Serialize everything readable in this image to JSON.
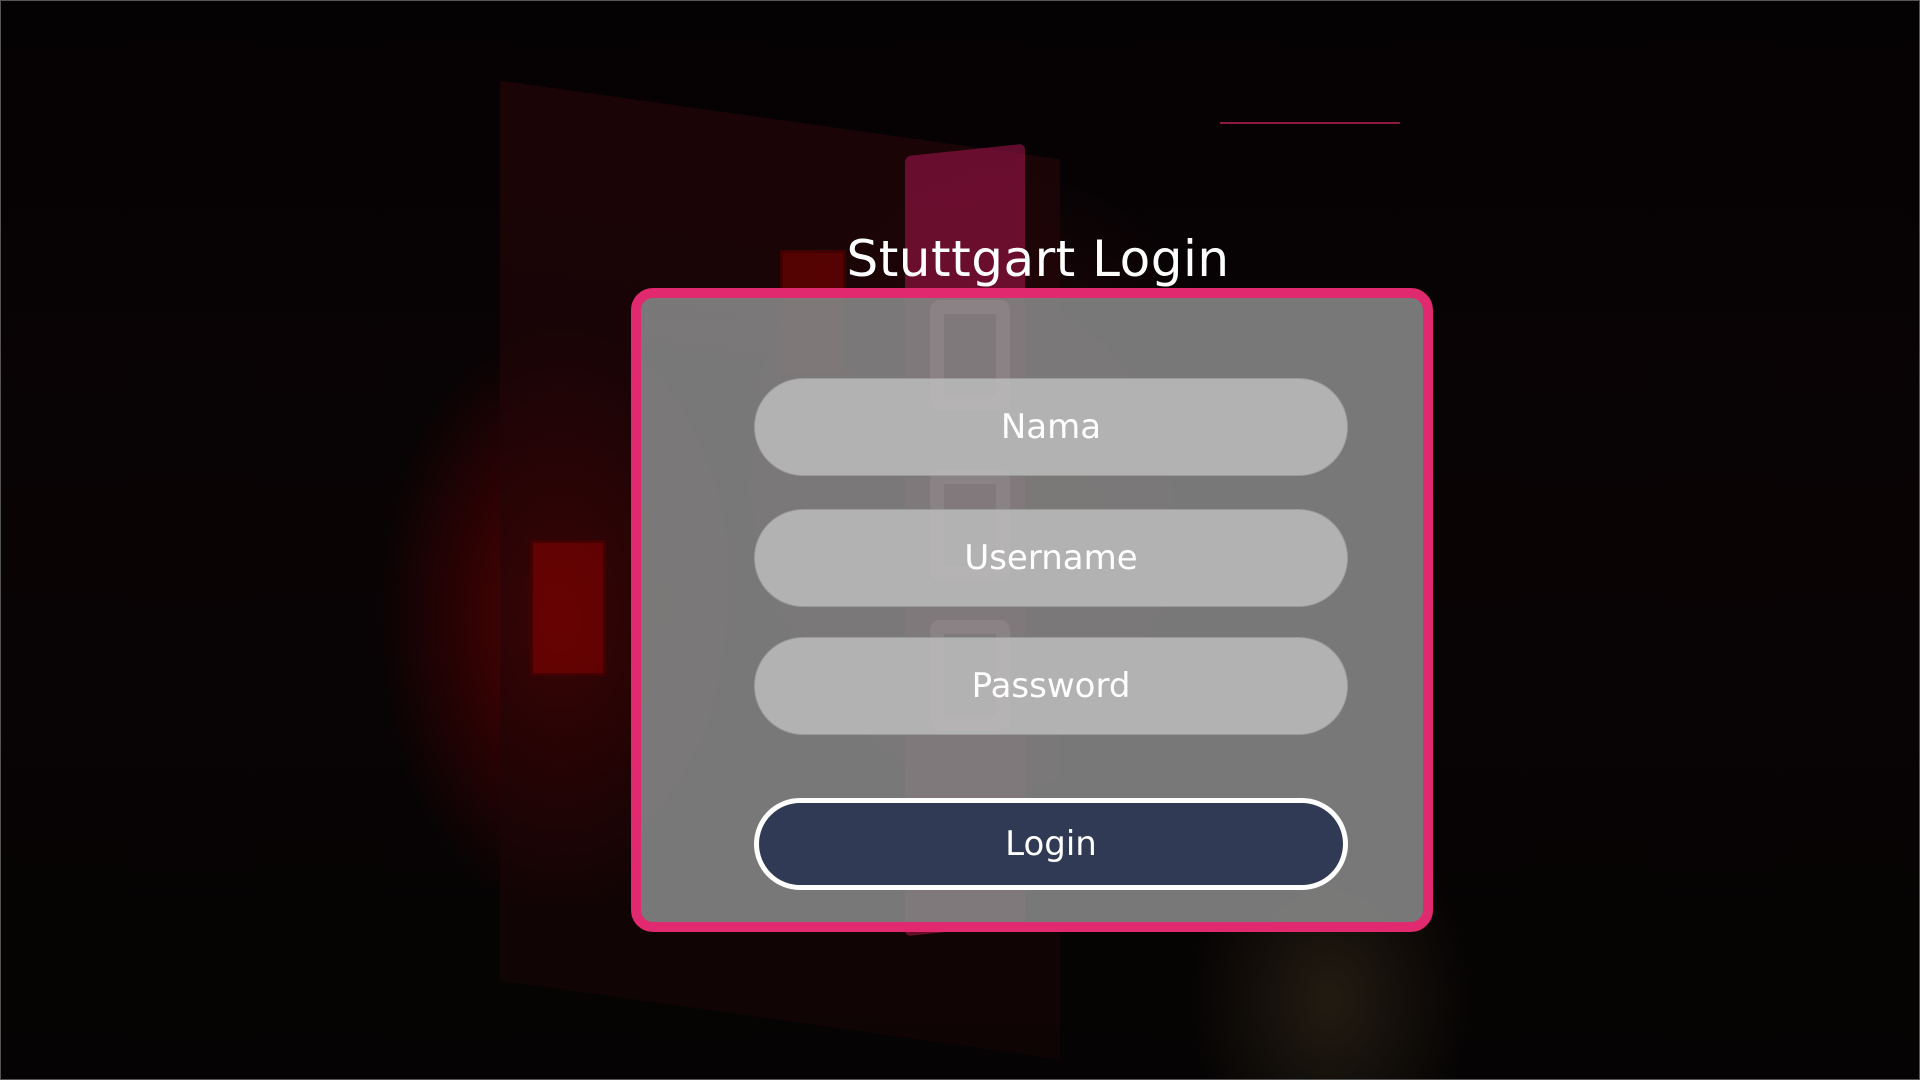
{
  "page": {
    "title": "Stuttgart Login"
  },
  "form": {
    "name_placeholder": "Nama",
    "username_placeholder": "Username",
    "password_placeholder": "Password",
    "submit_label": "Login"
  },
  "colors": {
    "accent": "#e0296e",
    "button_bg": "#313a54",
    "card_bg": "#828282",
    "text": "#ffffff"
  }
}
